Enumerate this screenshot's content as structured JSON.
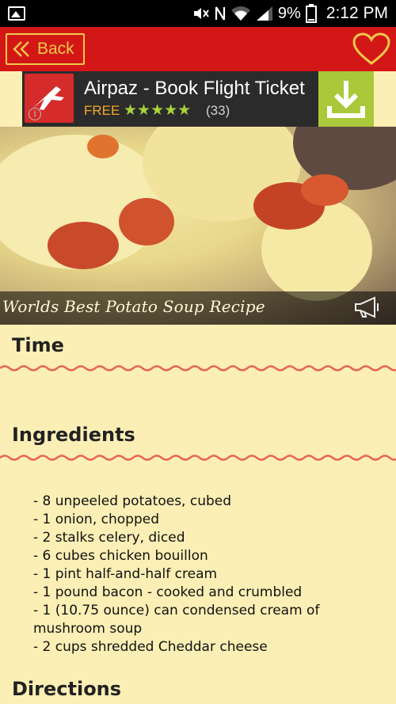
{
  "status_bar": {
    "battery_percent": "9%",
    "time": "2:12 PM"
  },
  "toolbar": {
    "back_label": "Back"
  },
  "ad": {
    "title": "Airpaz - Book Flight Ticket",
    "price_label": "FREE",
    "stars": "★★★★★",
    "rating_count": "(33)",
    "info_glyph": "i"
  },
  "recipe": {
    "title": "Worlds Best Potato Soup Recipe",
    "sections": {
      "time": "Time",
      "ingredients": "Ingredients",
      "directions": "Directions"
    },
    "ingredients": [
      " -  8 unpeeled potatoes, cubed",
      " -  1 onion, chopped",
      " -  2 stalks celery, diced",
      " -  6 cubes chicken bouillon",
      " -  1 pint half-and-half cream",
      " -  1 pound bacon - cooked and crumbled",
      " -  1 (10.75 ounce) can condensed cream of mushroom soup",
      " -  2 cups shredded Cheddar cheese"
    ]
  },
  "colors": {
    "toolbar": "#d31717",
    "accent_gold": "#f0c94a",
    "page_bg": "#fbefb5",
    "wave": "#e8644e",
    "download_green": "#a9c93a"
  },
  "icons": [
    "gallery-icon",
    "mute-icon",
    "nfc-icon",
    "wifi-icon",
    "signal-icon",
    "battery-icon",
    "chevron-left-double-icon",
    "heart-icon",
    "plane-icon",
    "info-icon",
    "download-icon",
    "megaphone-icon"
  ]
}
